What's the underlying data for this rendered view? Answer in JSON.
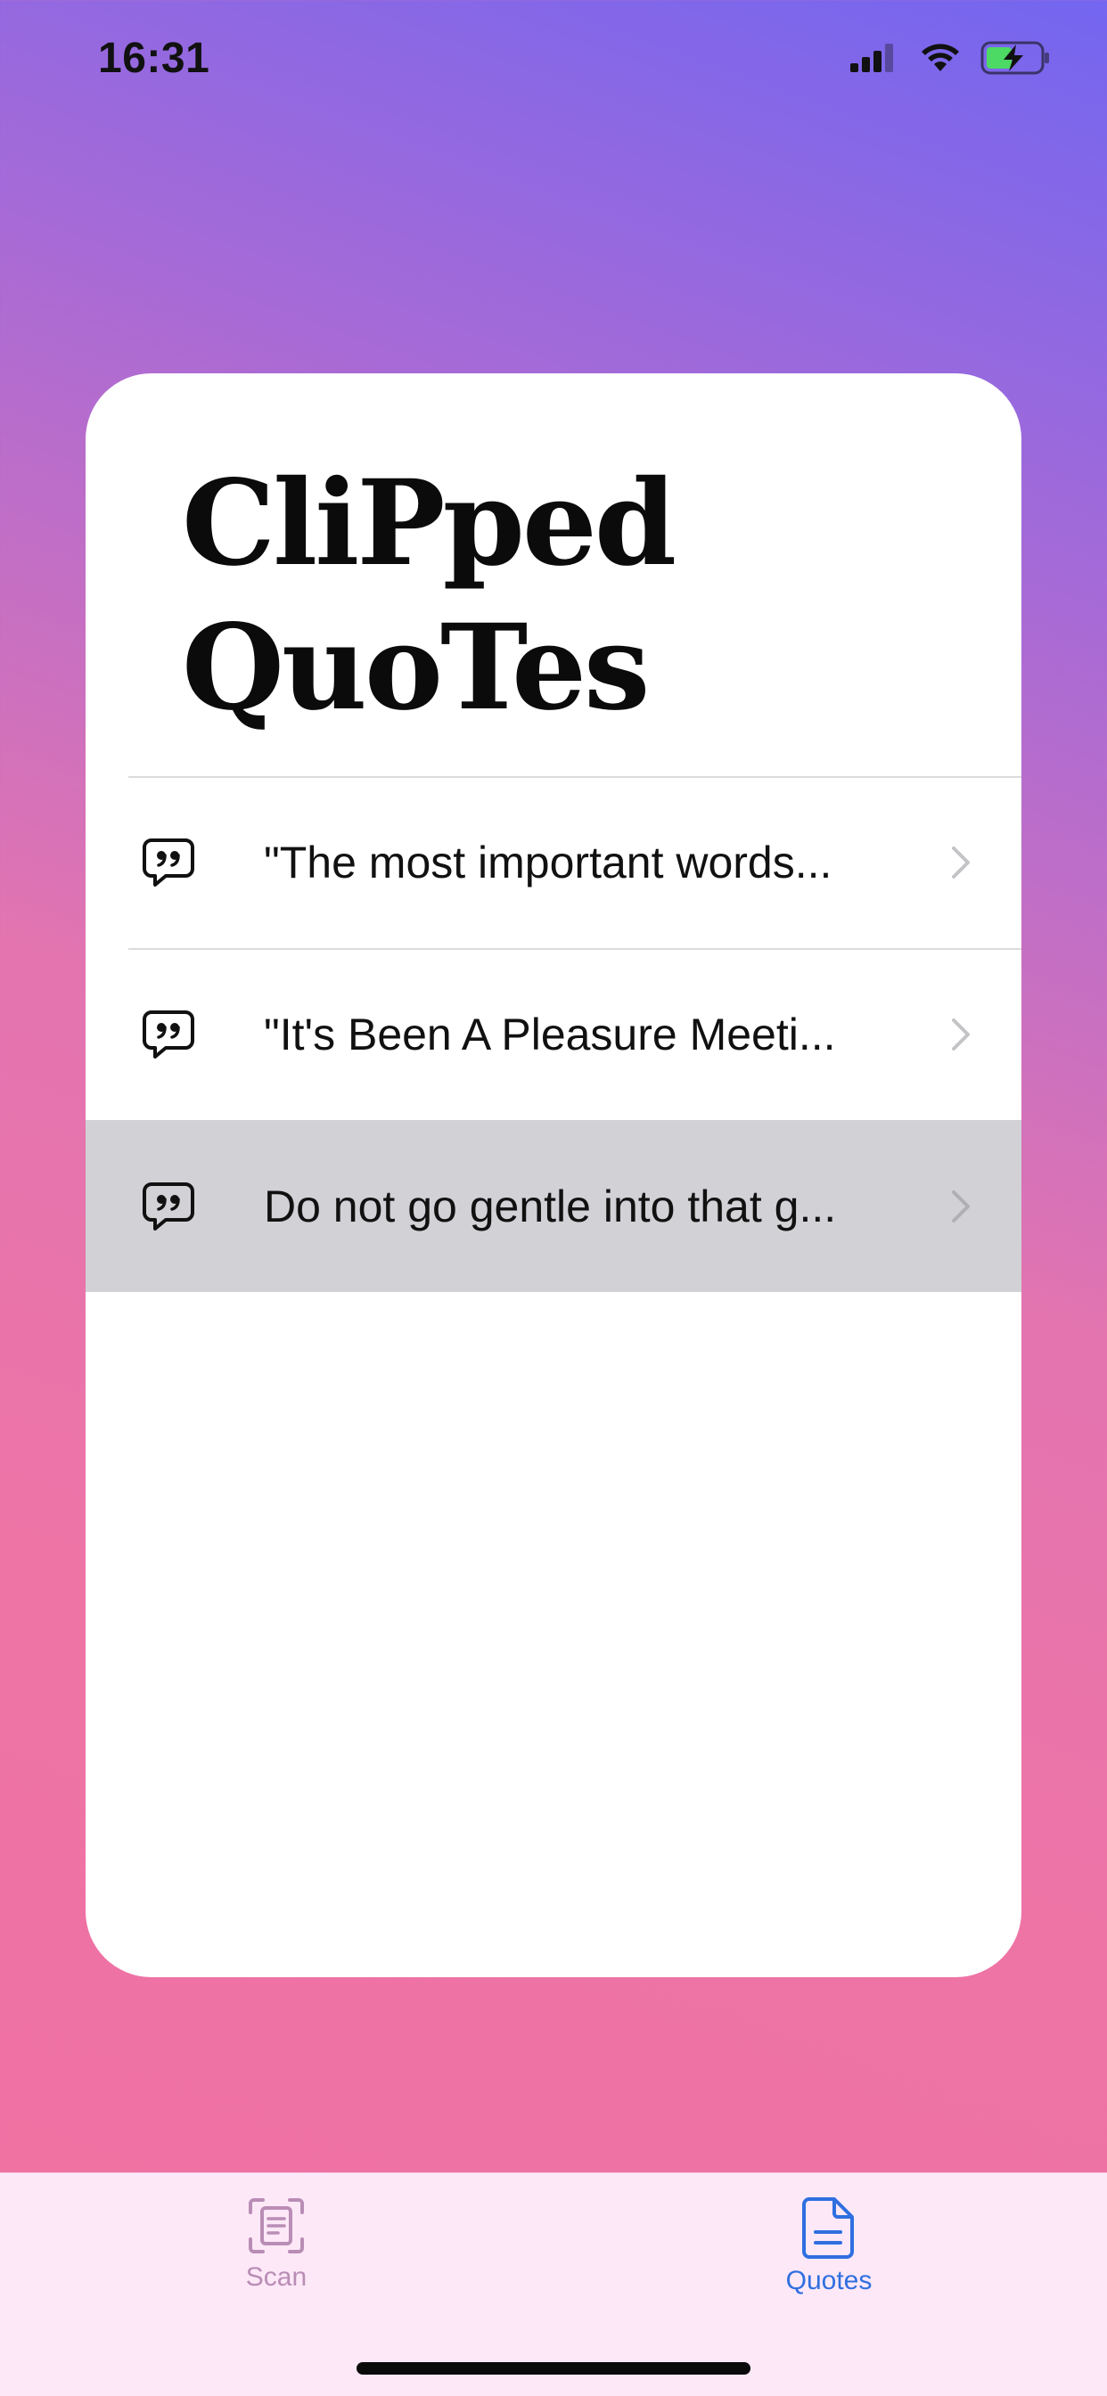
{
  "status_bar": {
    "time": "16:31",
    "icons": [
      "cellular-signal-icon",
      "wifi-icon",
      "battery-charging-icon"
    ]
  },
  "card": {
    "title_line1": "CliPped",
    "title_line2": "QuoTes"
  },
  "quotes": [
    {
      "text": "\"The most important words...",
      "icon": "quote-bubble-icon",
      "selected": false
    },
    {
      "text": "\"It's Been A Pleasure Meeti...",
      "icon": "quote-bubble-icon",
      "selected": false
    },
    {
      "text": "Do not go gentle into that g...",
      "icon": "quote-bubble-icon",
      "selected": true
    }
  ],
  "tab_bar": {
    "tabs": [
      {
        "label": "Scan",
        "icon": "scan-document-icon",
        "active": false
      },
      {
        "label": "Quotes",
        "icon": "document-icon",
        "active": true
      }
    ]
  },
  "colors": {
    "gradient_top": "#7366f0",
    "gradient_bottom": "#ef71a1",
    "tab_active": "#2f6fe0",
    "tab_inactive": "#b98db5",
    "selected_row": "#d1d1d6"
  }
}
